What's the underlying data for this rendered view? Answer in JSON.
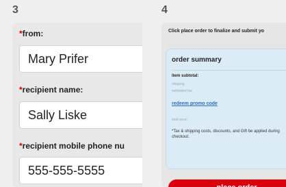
{
  "steps": {
    "left": "3",
    "right": "4"
  },
  "form": {
    "required_marker": "*",
    "from_label": "from:",
    "from_value": "Mary Prifer",
    "recipient_name_label": "recipient name:",
    "recipient_name_value": "Sally Liske",
    "recipient_phone_label": "recipient mobile phone nu",
    "recipient_phone_value": "555-555-5555"
  },
  "checkout": {
    "instructions": "Click place order to finalize and submit yo",
    "summary_title": "order summary",
    "item_subtotal_label": "item subtotal:",
    "shipping_label": "shipping",
    "tax_label": "estimated tax",
    "promo_link": "redeem promo code",
    "total_label": "total price:",
    "note": "*Tax & shipping costs, discounts, and Gift be applied during checkout.",
    "place_order_label": "place order"
  },
  "colors": {
    "accent_red": "#d9000d",
    "link_blue": "#2a6fc0",
    "summary_bg": "#dcecf7"
  }
}
